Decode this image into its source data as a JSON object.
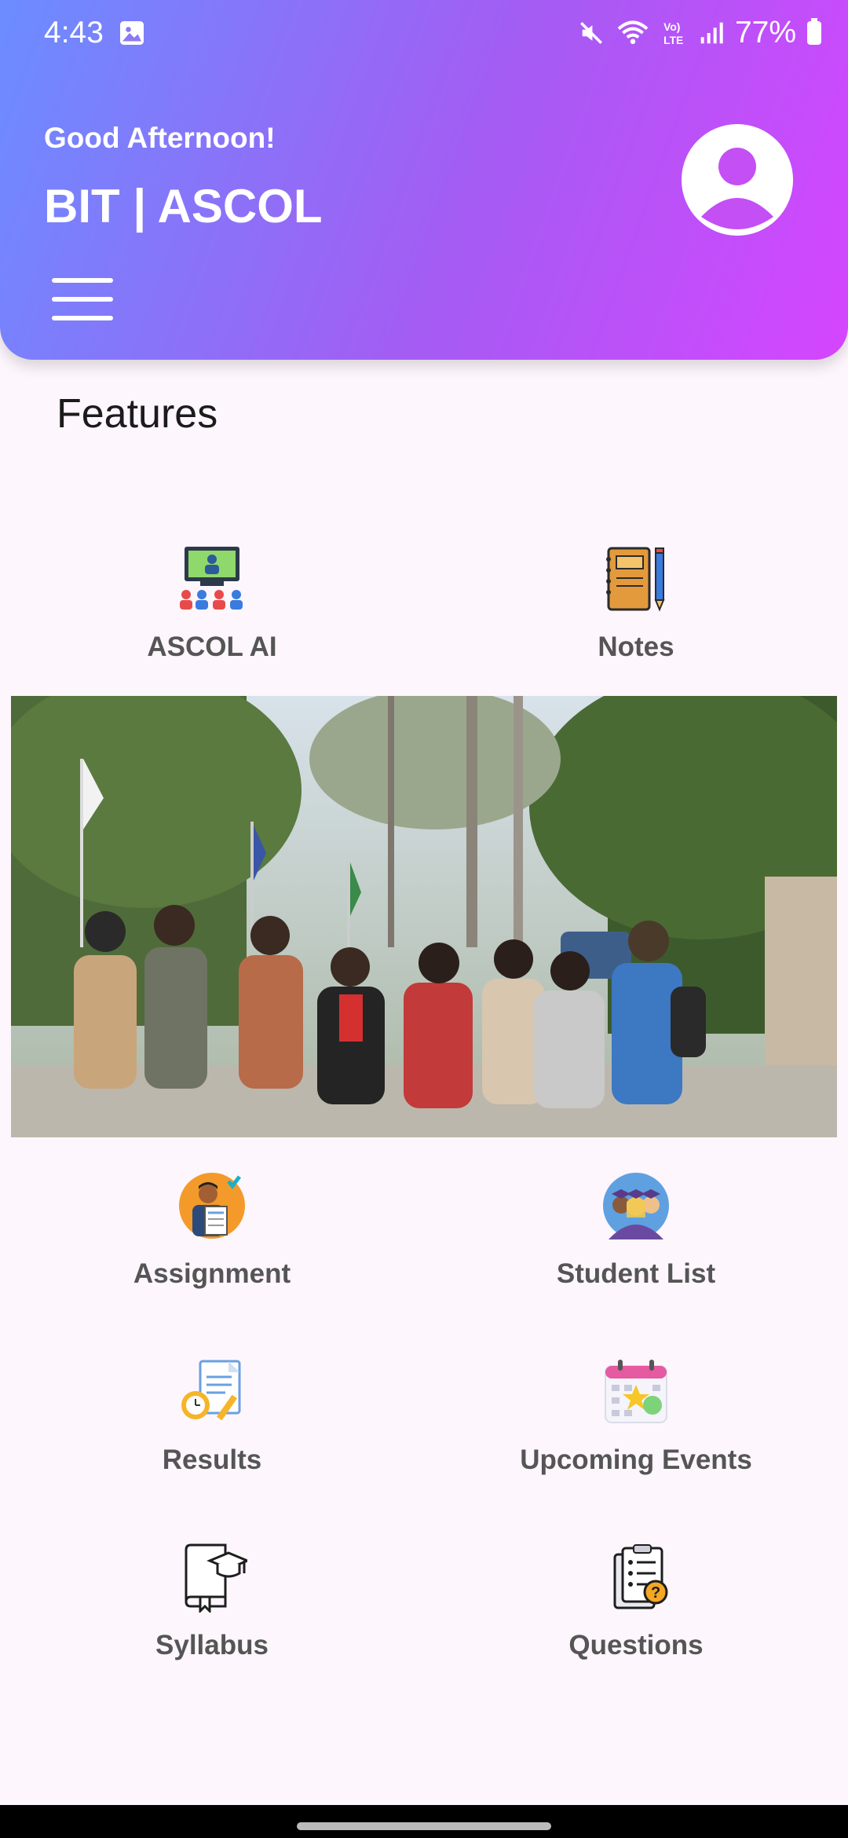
{
  "status_bar": {
    "time": "4:43",
    "battery": "77%",
    "icons": [
      "gallery-icon",
      "mute-icon",
      "wifi-icon",
      "volte-icon",
      "signal-icon",
      "battery-icon"
    ]
  },
  "header": {
    "greeting": "Good Afternoon!",
    "title": "BIT | ASCOL",
    "gradient": [
      "#6b8dff",
      "#a45cf3",
      "#d545ff"
    ]
  },
  "features": {
    "heading": "Features",
    "items": [
      {
        "label": "ASCOL AI",
        "icon": "classroom-icon"
      },
      {
        "label": "Notes",
        "icon": "notebook-icon"
      },
      {
        "label": "Assignment",
        "icon": "assignment-icon"
      },
      {
        "label": "Student List",
        "icon": "students-icon"
      },
      {
        "label": "Results",
        "icon": "results-icon"
      },
      {
        "label": "Upcoming Events",
        "icon": "calendar-icon"
      },
      {
        "label": "Syllabus",
        "icon": "syllabus-icon"
      },
      {
        "label": "Questions",
        "icon": "questions-icon"
      }
    ]
  },
  "banner": {
    "description_icon": "group-photo-image"
  }
}
